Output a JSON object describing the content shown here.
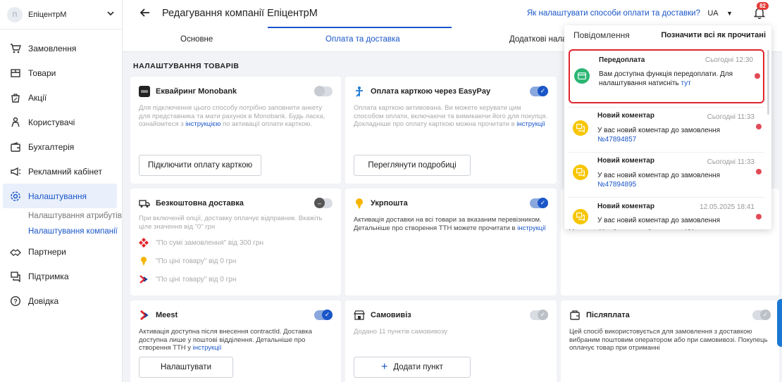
{
  "sidebar": {
    "company_initials": "П",
    "company_name": "ЕпіцентрМ",
    "items": [
      {
        "label": "Замовлення"
      },
      {
        "label": "Товари"
      },
      {
        "label": "Акції"
      },
      {
        "label": "Користувачі"
      },
      {
        "label": "Бухгалтерія"
      },
      {
        "label": "Рекламний кабінет"
      },
      {
        "label": "Налаштування"
      },
      {
        "label": "Партнери"
      },
      {
        "label": "Підтримка"
      },
      {
        "label": "Довідка"
      }
    ],
    "sub_items": [
      {
        "label": "Налаштування атрибутів"
      },
      {
        "label": "Налаштування компанії"
      }
    ]
  },
  "header": {
    "title": "Редагування компанії ЕпіцентрМ",
    "help_link": "Як налаштувати способи оплати та доставки?",
    "lang": "UA",
    "notif_count": "82"
  },
  "tabs": [
    {
      "label": "Основне"
    },
    {
      "label": "Оплата та доставка"
    },
    {
      "label": "Додаткові налаш"
    }
  ],
  "section_title": "НАЛАШТУВАННЯ ТОВАРІВ",
  "cards": {
    "monobank": {
      "title": "Еквайринг Monobank",
      "desc_1": "Для підключення цього способу потрібно заповнити анкету для представника та мати рахунок в Monobank. Будь ласка, ознайомтеся з ",
      "desc_link": "інструкцією",
      "desc_2": " по активації оплати карткою.",
      "button": "Підключити оплату карткою"
    },
    "easypay": {
      "title": "Оплата карткою через EasyPay",
      "desc_1": "Оплата карткою активована. Ви можете керувати цим способом оплати, включаючи та вимикаючи його для покупця. Докладніше про оплату карткою можна прочитати в ",
      "desc_link": "інструкції",
      "button": "Переглянути подробиці"
    },
    "free_delivery": {
      "title": "Безкоштовна доставка",
      "desc": "При включеній опції, доставку оплачує відправник. Вкажіть ціле значення від \"0\" грн",
      "options": [
        {
          "text": "\"По сумі замовлення\" від 300 грн"
        },
        {
          "text": "\"По ціні товару\" від 0 грн"
        },
        {
          "text": "\"По ціні товару\" від 0 грн"
        }
      ]
    },
    "ukrposhta": {
      "title": "Укрпошта",
      "desc_1": "Активація доставки на всі товари за вказаним перевізником. Детальніше про створення ТТН можете прочитати в ",
      "desc_link": "інструкції"
    },
    "hidden_card_desc": "Доставка доступна лише у поштові відділення.",
    "meest": {
      "title": "Meest",
      "desc_1": "Активація доступна після внесення contractId. Доставка доступна лише у поштові відділення. Детальніше про створення ТТН у ",
      "desc_link": "інструкції",
      "button": "Налаштувати"
    },
    "pickup": {
      "title": "Самовивіз",
      "desc": "Додано 11 пунктів самовивозу",
      "button": "Додати пункт"
    },
    "postpay": {
      "title": "Післяплата",
      "desc": "Цей спосіб використовується для замовлення з доставкою вибраним поштовим оператором або при самовивозі. Покупець оплачує товар при отриманні"
    }
  },
  "notifications": {
    "title": "Повідомлення",
    "mark_all": "Позначити всі як прочитані",
    "items": [
      {
        "title": "Передоплата",
        "time": "Сьогодні 12:30",
        "text": "Вам доступна функція передоплати. Для налаштування натисніть ",
        "link": "тут"
      },
      {
        "title": "Новий коментар",
        "time": "Сьогодні 11:33",
        "text": "У вас новий коментар до замовлення ",
        "link": "№47894857"
      },
      {
        "title": "Новий коментар",
        "time": "Сьогодні 11:33",
        "text": "У вас новий коментар до замовлення ",
        "link": "№47894895"
      },
      {
        "title": "Новий коментар",
        "time": "12.05.2025 18:41",
        "text": "У вас новий коментар до замовлення",
        "link": ""
      }
    ]
  },
  "colors": {
    "accent": "#1a56c8",
    "highlight_border": "#e0252c",
    "badge": "#e53935"
  }
}
